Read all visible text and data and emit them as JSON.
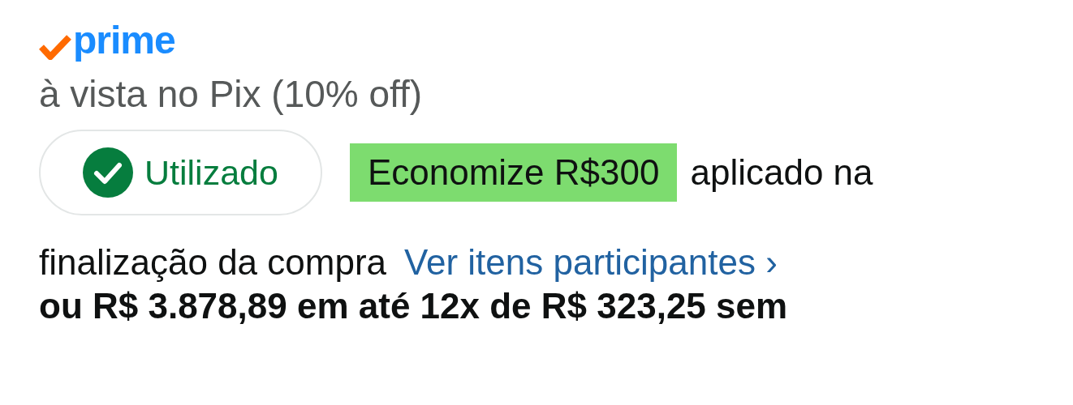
{
  "prime_logo": {
    "text": "prime"
  },
  "pix_price": {
    "caption": "à vista no Pix (10% off)"
  },
  "coupon": {
    "status": "Utilizado",
    "applied": true,
    "badge": "Economize R$300",
    "text_lines": [
      "aplicado na",
      "finalização da compra"
    ],
    "link": "Ver itens participantes",
    "link_chevron": "›"
  },
  "installments": "ou R$ 3.878,89 em até 12x de R$ 323,25 sem"
}
